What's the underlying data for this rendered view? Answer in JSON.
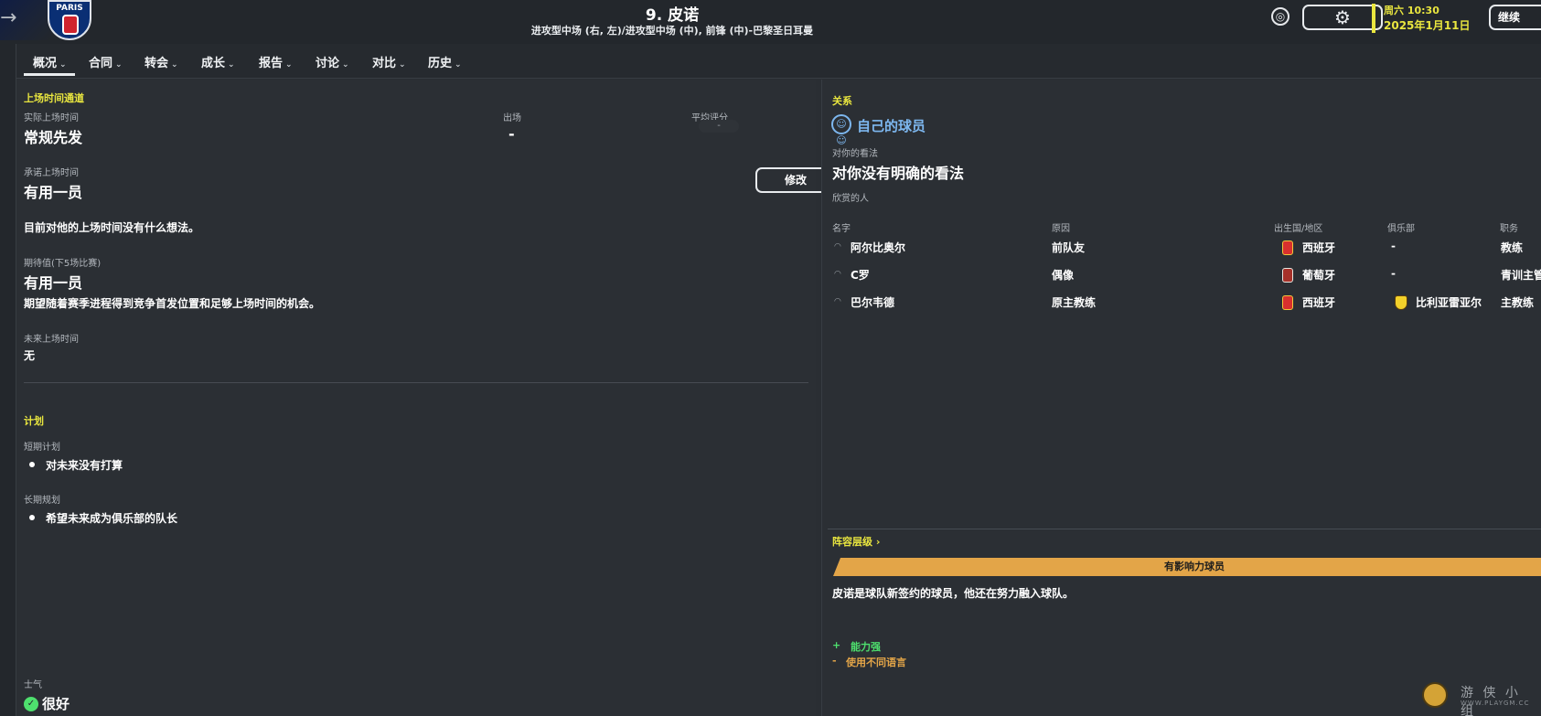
{
  "header": {
    "title": "9. 皮诺",
    "subtitle": "进攻型中场 (右, 左)/进攻型中场 (中), 前锋 (中)-巴黎圣日耳曼",
    "crest_text": "PARIS",
    "date_time": "周六 10:30",
    "date": "2025年1月11日",
    "continue_label": "继续"
  },
  "tabs": [
    {
      "label": "概况"
    },
    {
      "label": "合同"
    },
    {
      "label": "转会"
    },
    {
      "label": "成长"
    },
    {
      "label": "报告"
    },
    {
      "label": "讨论"
    },
    {
      "label": "对比"
    },
    {
      "label": "历史"
    }
  ],
  "left": {
    "playtime_heading": "上场时间通道",
    "actual_label": "实际上场时间",
    "actual_value": "常规先发",
    "appearances_label": "出场",
    "appearances_value": "-",
    "avg_rating_label": "平均评分",
    "avg_rating_value": "-",
    "promised_label": "承诺上场时间",
    "promised_value": "有用一员",
    "edit_label": "修改",
    "current_thought": "目前对他的上场时间没有什么想法。",
    "expectation_label": "期待值(下5场比赛)",
    "expectation_value": "有用一员",
    "expectation_desc": "期望随着赛季进程得到竞争首发位置和足够上场时间的机会。",
    "future_label": "未来上场时间",
    "future_value": "无",
    "plans_heading": "计划",
    "short_plan_label": "短期计划",
    "short_plan_item": "对未来没有打算",
    "long_plan_label": "长期规划",
    "long_plan_item": "希望未来成为俱乐部的队长",
    "morale_label": "士气",
    "morale_value": "很好"
  },
  "right": {
    "relations_heading": "关系",
    "own_player": "自己的球员",
    "opinion_label": "对你的看法",
    "opinion_value": "对你没有明确的看法",
    "admired_label": "欣赏的人",
    "columns": [
      "名字",
      "原因",
      "出生国/地区",
      "俱乐部",
      "职务"
    ],
    "rows": [
      {
        "name": "阿尔比奥尔",
        "reason": "前队友",
        "country": "西班牙",
        "club": "-",
        "role": "教练"
      },
      {
        "name": "C罗",
        "reason": "偶像",
        "country": "葡萄牙",
        "club": "-",
        "role": "青训主管"
      },
      {
        "name": "巴尔韦德",
        "reason": "原主教练",
        "country": "西班牙",
        "club": "比利亚雷亚尔",
        "role": "主教练"
      }
    ],
    "hierarchy_link": "阵容层级 ›",
    "hierarchy_banner": "有影响力球员",
    "hierarchy_desc": "皮诺是球队新签约的球员，他还在努力融入球队。",
    "pro_sign": "+",
    "pro_text": "能力强",
    "con_sign": "-",
    "con_text": "使用不同语言"
  },
  "watermark": {
    "top": "游 侠 小 组",
    "bottom": "WWW.PLAYGM.CC"
  }
}
